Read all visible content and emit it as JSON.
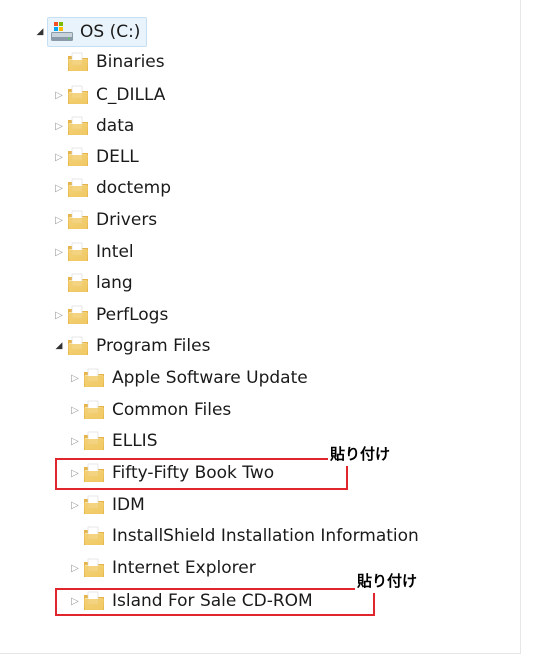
{
  "tree": {
    "root": {
      "label": "OS (C:)",
      "expanded": true
    },
    "root_children": [
      {
        "label": "Binaries",
        "has_children": false
      },
      {
        "label": "C_DILLA",
        "has_children": true
      },
      {
        "label": "data",
        "has_children": true
      },
      {
        "label": "DELL",
        "has_children": true
      },
      {
        "label": "doctemp",
        "has_children": true
      },
      {
        "label": "Drivers",
        "has_children": true
      },
      {
        "label": "Intel",
        "has_children": true
      },
      {
        "label": "lang",
        "has_children": false
      },
      {
        "label": "PerfLogs",
        "has_children": true
      },
      {
        "label": "Program Files",
        "has_children": true,
        "expanded": true
      }
    ],
    "program_files_children": [
      {
        "label": "Apple Software Update",
        "has_children": true
      },
      {
        "label": "Common Files",
        "has_children": true
      },
      {
        "label": "ELLIS",
        "has_children": true
      },
      {
        "label": "Fifty-Fifty Book Two",
        "has_children": true,
        "highlighted": true
      },
      {
        "label": "IDM",
        "has_children": true
      },
      {
        "label": "InstallShield Installation Information",
        "has_children": false
      },
      {
        "label": "Internet Explorer",
        "has_children": true
      },
      {
        "label": "Island For Sale CD-ROM",
        "has_children": true,
        "highlighted": true
      }
    ]
  },
  "annotations": {
    "note_1": "貼り付け",
    "note_2": "貼り付け",
    "highlight_color": "#e0262c"
  },
  "icons": {
    "drive": "drive-icon",
    "folder": "folder-icon",
    "collapsed_arrow": "expand-arrow-icon",
    "expanded_arrow": "collapse-arrow-icon"
  }
}
